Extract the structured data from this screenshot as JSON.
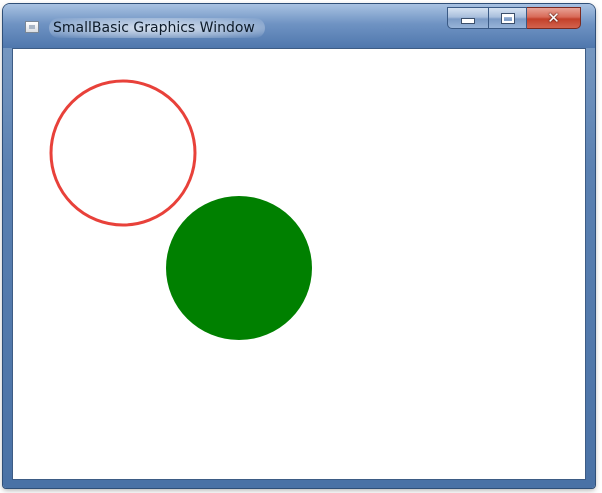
{
  "window": {
    "title": "SmallBasic Graphics Window",
    "icon": "app-icon",
    "controls": {
      "minimize_icon": "minimize-icon",
      "maximize_icon": "maximize-icon",
      "close_icon": "close-icon",
      "close_glyph": "✕"
    }
  },
  "canvas": {
    "background_color": "#ffffff",
    "shapes": [
      {
        "kind": "ellipse",
        "name": "red-circle",
        "fill": "none",
        "stroke": "#e8413a"
      },
      {
        "kind": "ellipse",
        "name": "green-circle",
        "fill": "#008000",
        "stroke": "none"
      }
    ]
  }
}
